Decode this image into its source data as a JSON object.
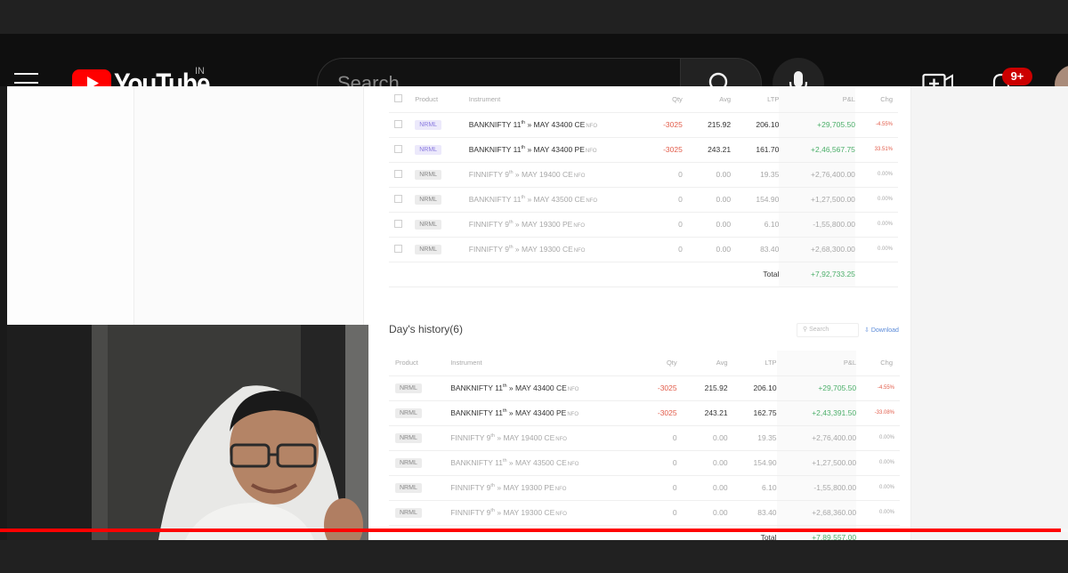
{
  "header": {
    "logo_text": "YouTube",
    "region": "IN",
    "search_placeholder": "Search",
    "notification_count": "9+"
  },
  "video": {
    "progress_fraction": 0.993,
    "positions": {
      "columns": [
        "Product",
        "Instrument",
        "Qty",
        "Avg",
        "LTP",
        "P&L",
        "Chg"
      ],
      "rows": [
        {
          "product": "NRML",
          "active": true,
          "symbol": "BANKNIFTY 11",
          "sup": "th",
          "rest": " MAY 43400 CE",
          "exch": "NFO",
          "qty": "-3025",
          "avg": "215.92",
          "ltp": "206.10",
          "pnl": "+29,705.50",
          "chg": "-4.55%"
        },
        {
          "product": "NRML",
          "active": true,
          "symbol": "BANKNIFTY 11",
          "sup": "th",
          "rest": " MAY 43400 PE",
          "exch": "NFO",
          "qty": "-3025",
          "avg": "243.21",
          "ltp": "161.70",
          "pnl": "+2,46,567.75",
          "chg": "33.51%"
        },
        {
          "product": "NRML",
          "active": false,
          "symbol": "FINNIFTY 9",
          "sup": "th",
          "rest": " MAY 19400 CE",
          "exch": "NFO",
          "qty": "0",
          "avg": "0.00",
          "ltp": "19.35",
          "pnl": "+2,76,400.00",
          "chg": "0.00%"
        },
        {
          "product": "NRML",
          "active": false,
          "symbol": "BANKNIFTY 11",
          "sup": "th",
          "rest": " MAY 43500 CE",
          "exch": "NFO",
          "qty": "0",
          "avg": "0.00",
          "ltp": "154.90",
          "pnl": "+1,27,500.00",
          "chg": "0.00%"
        },
        {
          "product": "NRML",
          "active": false,
          "symbol": "FINNIFTY 9",
          "sup": "th",
          "rest": " MAY 19300 PE",
          "exch": "NFO",
          "qty": "0",
          "avg": "0.00",
          "ltp": "6.10",
          "pnl": "-1,55,800.00",
          "chg": "0.00%"
        },
        {
          "product": "NRML",
          "active": false,
          "symbol": "FINNIFTY 9",
          "sup": "th",
          "rest": " MAY 19300 CE",
          "exch": "NFO",
          "qty": "0",
          "avg": "0.00",
          "ltp": "83.40",
          "pnl": "+2,68,300.00",
          "chg": "0.00%"
        }
      ],
      "total_label": "Total",
      "total_value": "+7,92,733.25"
    },
    "day_history": {
      "title": "Day's history(6)",
      "search_placeholder": "Search",
      "download_label": "Download",
      "columns": [
        "Product",
        "Instrument",
        "Qty",
        "Avg",
        "LTP",
        "P&L",
        "Chg"
      ],
      "rows": [
        {
          "product": "NRML",
          "symbol": "BANKNIFTY 11",
          "sup": "th",
          "rest": " MAY 43400 CE",
          "exch": "NFO",
          "qty": "-3025",
          "avg": "215.92",
          "ltp": "206.10",
          "pnl": "+29,705.50",
          "chg": "-4.55%"
        },
        {
          "product": "NRML",
          "symbol": "BANKNIFTY 11",
          "sup": "th",
          "rest": " MAY 43400 PE",
          "exch": "NFO",
          "qty": "-3025",
          "avg": "243.21",
          "ltp": "162.75",
          "pnl": "+2,43,391.50",
          "chg": "-33.08%"
        },
        {
          "product": "NRML",
          "symbol": "FINNIFTY 9",
          "sup": "th",
          "rest": " MAY 19400 CE",
          "exch": "NFO",
          "qty": "0",
          "avg": "0.00",
          "ltp": "19.35",
          "pnl": "+2,76,400.00",
          "chg": "0.00%"
        },
        {
          "product": "NRML",
          "symbol": "BANKNIFTY 11",
          "sup": "th",
          "rest": " MAY 43500 CE",
          "exch": "NFO",
          "qty": "0",
          "avg": "0.00",
          "ltp": "154.90",
          "pnl": "+1,27,500.00",
          "chg": "0.00%"
        },
        {
          "product": "NRML",
          "symbol": "FINNIFTY 9",
          "sup": "th",
          "rest": " MAY 19300 PE",
          "exch": "NFO",
          "qty": "0",
          "avg": "0.00",
          "ltp": "6.10",
          "pnl": "-1,55,800.00",
          "chg": "0.00%"
        },
        {
          "product": "NRML",
          "symbol": "FINNIFTY 9",
          "sup": "th",
          "rest": " MAY 19300 CE",
          "exch": "NFO",
          "qty": "0",
          "avg": "0.00",
          "ltp": "83.40",
          "pnl": "+2,68,360.00",
          "chg": "0.00%"
        }
      ],
      "total_label": "Total",
      "total_value": "+7,89,557.00"
    }
  }
}
